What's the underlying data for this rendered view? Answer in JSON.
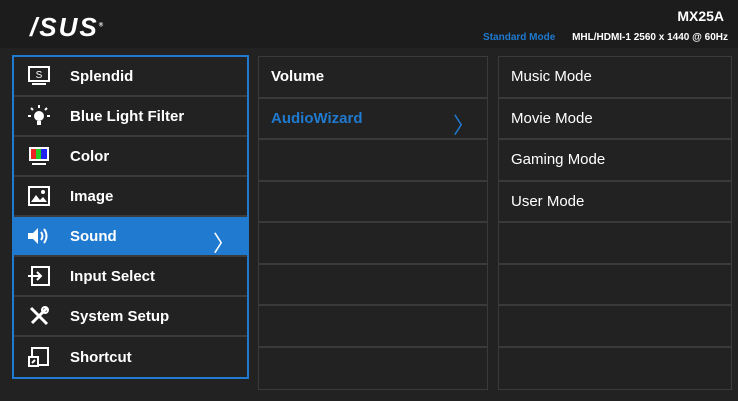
{
  "header": {
    "logo": "/SUS",
    "model": "MX25A",
    "mode": "Standard Mode",
    "input": "MHL/HDMI-1",
    "resolution": "2560 x 1440 @ 60Hz"
  },
  "menu": [
    {
      "label": "Splendid",
      "icon": "splendid-icon"
    },
    {
      "label": "Blue Light Filter",
      "icon": "light-bulb-icon"
    },
    {
      "label": "Color",
      "icon": "color-icon"
    },
    {
      "label": "Image",
      "icon": "image-icon"
    },
    {
      "label": "Sound",
      "icon": "speaker-icon",
      "selected": true
    },
    {
      "label": "Input Select",
      "icon": "input-icon"
    },
    {
      "label": "System Setup",
      "icon": "wrench-icon"
    },
    {
      "label": "Shortcut",
      "icon": "shortcut-icon"
    }
  ],
  "submenu": [
    {
      "label": "Volume"
    },
    {
      "label": "AudioWizard",
      "selected": true
    },
    {
      "label": ""
    },
    {
      "label": ""
    },
    {
      "label": ""
    },
    {
      "label": ""
    },
    {
      "label": ""
    },
    {
      "label": ""
    }
  ],
  "options": [
    {
      "label": "Music Mode"
    },
    {
      "label": "Movie Mode"
    },
    {
      "label": "Gaming Mode"
    },
    {
      "label": "User Mode"
    },
    {
      "label": ""
    },
    {
      "label": ""
    },
    {
      "label": ""
    },
    {
      "label": ""
    }
  ],
  "colors": {
    "accent": "#1f7ad0",
    "background": "#222222"
  }
}
